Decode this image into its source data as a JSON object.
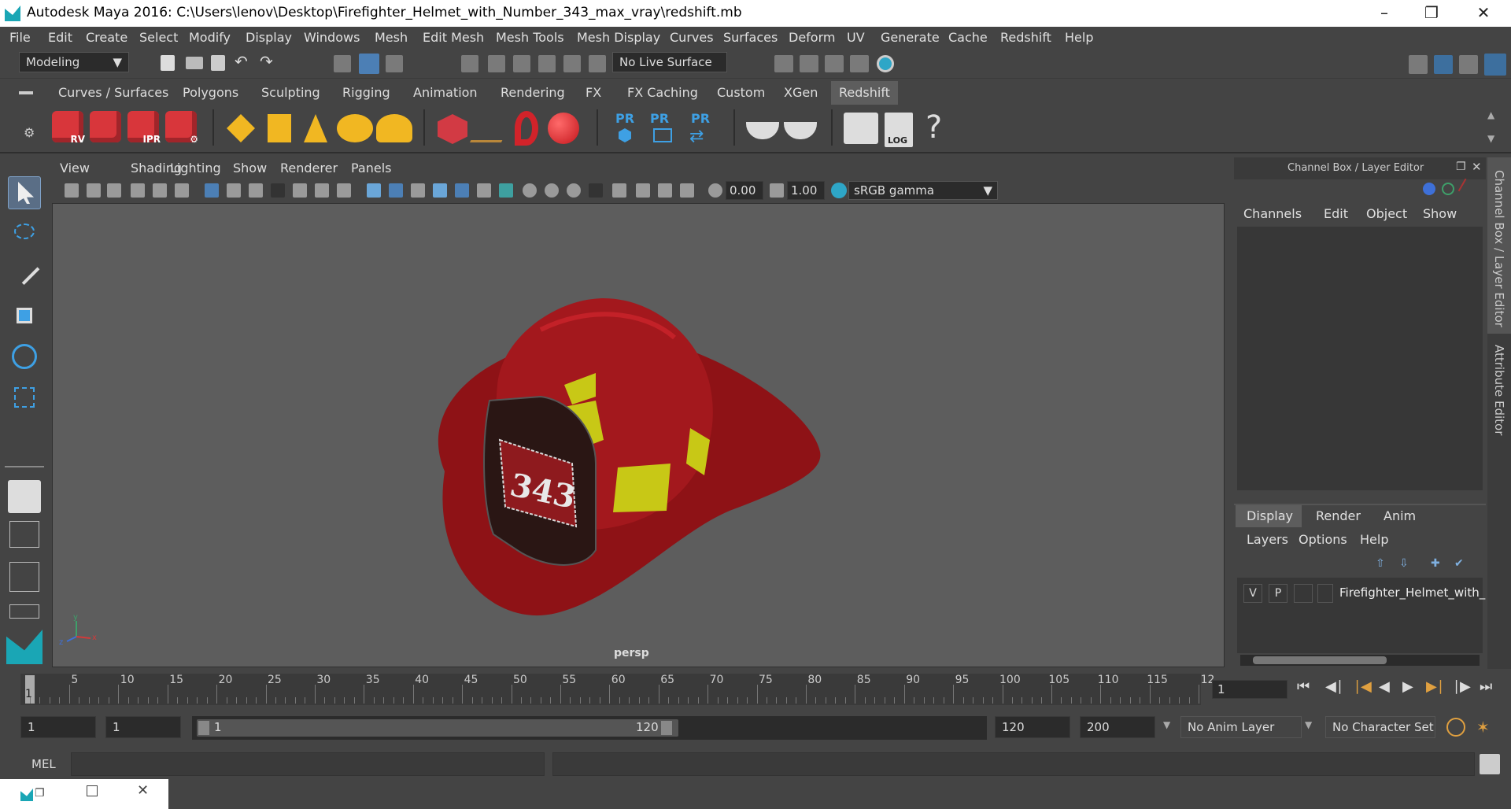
{
  "window": {
    "title": "Autodesk Maya 2016: C:\\Users\\lenov\\Desktop\\Firefighter_Helmet_with_Number_343_max_vray\\redshift.mb"
  },
  "menubar": [
    "File",
    "Edit",
    "Create",
    "Select",
    "Modify",
    "Display",
    "Windows",
    "Mesh",
    "Edit Mesh",
    "Mesh Tools",
    "Mesh Display",
    "Curves",
    "Surfaces",
    "Deform",
    "UV",
    "Generate",
    "Cache",
    "Redshift",
    "Help"
  ],
  "status": {
    "mode": "Modeling",
    "live_surface": "No Live Surface"
  },
  "shelf": {
    "tabs": [
      "Curves / Surfaces",
      "Polygons",
      "Sculpting",
      "Rigging",
      "Animation",
      "Rendering",
      "FX",
      "FX Caching",
      "Custom",
      "XGen",
      "Redshift"
    ],
    "active_tab": "Redshift",
    "rs_labels": [
      "RV",
      "",
      "IPR",
      ""
    ],
    "pr_labels": [
      "PR",
      "PR",
      "PR"
    ],
    "log_label": "LOG",
    "help_glyph": "?"
  },
  "viewport": {
    "menu": [
      "View",
      "Shading",
      "Lighting",
      "Show",
      "Renderer",
      "Panels"
    ],
    "exposure": "0.00",
    "gamma": "1.00",
    "color_space": "sRGB gamma",
    "camera_label": "persp",
    "helmet_number": "343",
    "axis_x": "x",
    "axis_y": "y",
    "axis_z": "z"
  },
  "channel_box": {
    "title": "Channel Box / Layer Editor",
    "menu": [
      "Channels",
      "Edit",
      "Object",
      "Show"
    ],
    "layer_tabs": [
      "Display",
      "Render",
      "Anim"
    ],
    "layer_menu": [
      "Layers",
      "Options",
      "Help"
    ],
    "layer_row": {
      "v": "V",
      "p": "P",
      "name": "Firefighter_Helmet_with_"
    }
  },
  "side_tabs": [
    "Channel Box / Layer Editor",
    "Attribute Editor"
  ],
  "timeline": {
    "ticks": [
      "5",
      "10",
      "15",
      "20",
      "25",
      "30",
      "35",
      "40",
      "45",
      "50",
      "55",
      "60",
      "65",
      "70",
      "75",
      "80",
      "85",
      "90",
      "95",
      "100",
      "105",
      "110",
      "115",
      "12"
    ],
    "start_marker": "1",
    "current_frame": "1"
  },
  "range": {
    "start": "1",
    "playback_start": "1",
    "slider_start": "1",
    "slider_end": "120",
    "playback_end": "120",
    "end": "200",
    "anim_layer": "No Anim Layer",
    "character_set": "No Character Set"
  },
  "cmdline": {
    "label": "MEL"
  }
}
